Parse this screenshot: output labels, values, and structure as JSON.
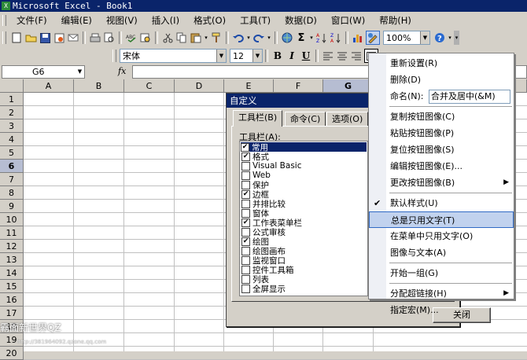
{
  "window": {
    "title": "Microsoft Excel - Book1"
  },
  "menubar": {
    "items": [
      "文件(F)",
      "编辑(E)",
      "视图(V)",
      "插入(I)",
      "格式(O)",
      "工具(T)",
      "数据(D)",
      "窗口(W)",
      "帮助(H)"
    ]
  },
  "standard_toolbar": {
    "zoom": "100%",
    "icons": [
      "new-icon",
      "open-icon",
      "save-icon",
      "permission-icon",
      "email-icon",
      "print-icon",
      "print-preview-icon",
      "spelling-icon",
      "research-icon",
      "cut-icon",
      "copy-icon",
      "paste-icon",
      "format-painter-icon",
      "undo-icon",
      "redo-icon",
      "hyperlink-icon",
      "autosum-icon",
      "sort-asc-icon",
      "sort-desc-icon",
      "chart-wizard-icon",
      "drawing-icon"
    ]
  },
  "formatting_toolbar": {
    "font": "宋体",
    "size": "12",
    "bold": "B",
    "italic": "I",
    "underline": "U"
  },
  "formula_bar": {
    "name_box": "G6",
    "fx": "fx",
    "value": ""
  },
  "grid": {
    "columns": [
      "A",
      "B",
      "C",
      "D",
      "E",
      "F",
      "G"
    ],
    "rows": [
      "1",
      "2",
      "3",
      "4",
      "5",
      "6",
      "7",
      "8",
      "9",
      "10",
      "11",
      "12",
      "13",
      "14",
      "15",
      "16",
      "17",
      "18",
      "19",
      "20"
    ],
    "selected_row": "6",
    "selected_col": "G"
  },
  "dialog": {
    "title": "自定义",
    "tabs": [
      "工具栏(B)",
      "命令(C)",
      "选项(O)"
    ],
    "active_tab": "工具栏(B)",
    "list_label": "工具栏(A):",
    "toolbars": [
      {
        "label": "常用",
        "checked": true,
        "selected": true
      },
      {
        "label": "格式",
        "checked": true
      },
      {
        "label": "Visual Basic",
        "checked": false
      },
      {
        "label": "Web",
        "checked": false
      },
      {
        "label": "保护",
        "checked": false
      },
      {
        "label": "边框",
        "checked": true
      },
      {
        "label": "并排比较",
        "checked": false
      },
      {
        "label": "窗体",
        "checked": false
      },
      {
        "label": "工作表菜单栏",
        "checked": true
      },
      {
        "label": "公式审核",
        "checked": false
      },
      {
        "label": "绘图",
        "checked": true
      },
      {
        "label": "绘图画布",
        "checked": false
      },
      {
        "label": "监视窗口",
        "checked": false
      },
      {
        "label": "控件工具箱",
        "checked": false
      },
      {
        "label": "列表",
        "checked": false
      },
      {
        "label": "全屏显示",
        "checked": false
      }
    ],
    "close_button": "关闭"
  },
  "context_menu": {
    "items": [
      {
        "label": "重新设置(R)"
      },
      {
        "label": "删除(D)"
      },
      {
        "label": "命名(N):",
        "field_value": "合并及居中(&M)"
      },
      {
        "sep": true
      },
      {
        "label": "复制按钮图像(C)"
      },
      {
        "label": "粘贴按钮图像(P)"
      },
      {
        "label": "复位按钮图像(S)"
      },
      {
        "label": "编辑按钮图像(E)..."
      },
      {
        "label": "更改按钮图像(B)",
        "submenu": true
      },
      {
        "sep": true
      },
      {
        "label": "默认样式(U)",
        "checked": true
      },
      {
        "label": "总是只用文字(T)",
        "highlighted": true
      },
      {
        "label": "在菜单中只用文字(O)"
      },
      {
        "label": "图像与文本(A)"
      },
      {
        "sep": true
      },
      {
        "label": "开始一组(G)"
      },
      {
        "sep": true
      },
      {
        "label": "分配超链接(H)",
        "submenu": true
      },
      {
        "label": "指定宏(M)..."
      }
    ]
  },
  "watermark": {
    "line1": "霸面新世界QZ",
    "line2": "http://381964092.qzone.qq.com"
  },
  "colors": {
    "title_bg": "#0a246a",
    "highlight": "#c1d2ee",
    "face": "#d4d0c8"
  }
}
